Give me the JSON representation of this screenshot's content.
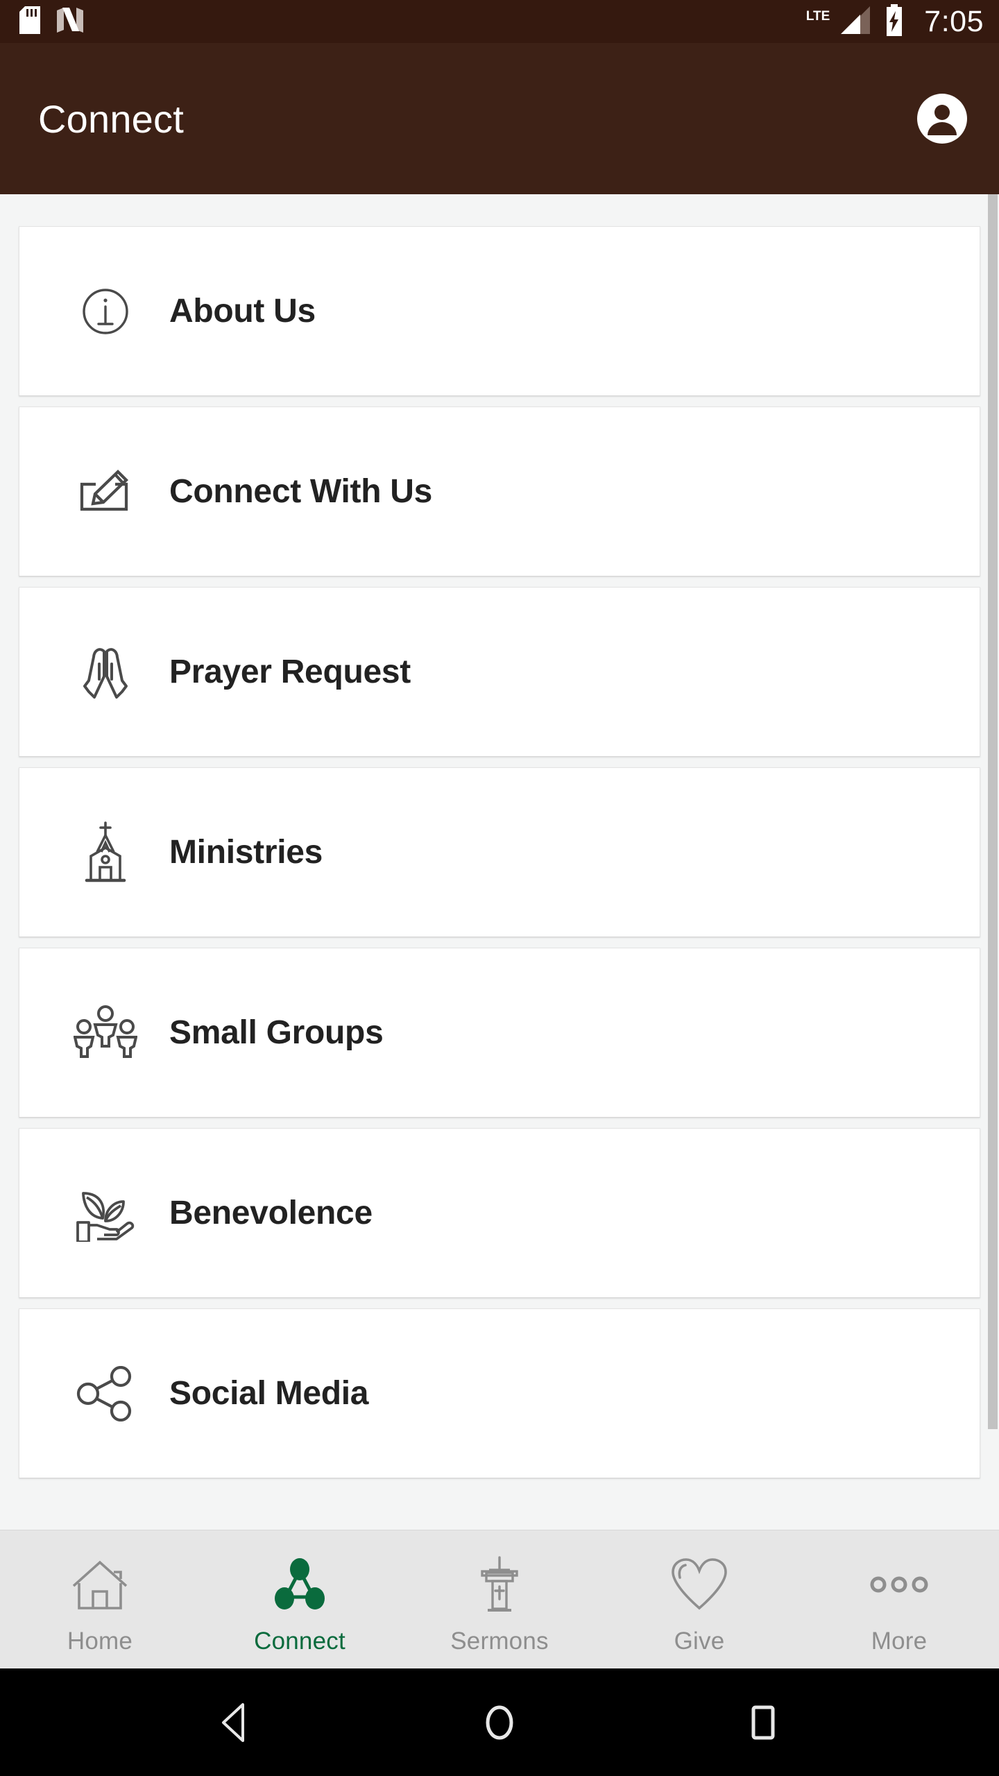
{
  "status_bar": {
    "time": "7:05",
    "network_label": "LTE",
    "icons": [
      "sd-card-icon",
      "nfc-icon",
      "signal-bars-icon",
      "battery-charging-icon"
    ],
    "background_color": "#35190f"
  },
  "app_bar": {
    "title": "Connect",
    "background_color": "#3d2116",
    "avatar_icon": "account-circle-icon"
  },
  "content": {
    "background_color": "#f4f5f5",
    "scrollbar_visible": true,
    "items": [
      {
        "label": "About Us",
        "icon": "info-circle-icon"
      },
      {
        "label": "Connect With Us",
        "icon": "pencil-write-icon"
      },
      {
        "label": "Prayer Request",
        "icon": "praying-hands-icon"
      },
      {
        "label": "Ministries",
        "icon": "church-icon"
      },
      {
        "label": "Small Groups",
        "icon": "people-group-icon"
      },
      {
        "label": "Benevolence",
        "icon": "hand-holding-plant-icon"
      },
      {
        "label": "Social Media",
        "icon": "share-network-icon"
      }
    ]
  },
  "bottom_nav": {
    "active_color": "#0a6b3d",
    "inactive_color": "#8e8e8e",
    "background_color": "#e6e6e6",
    "items": [
      {
        "label": "Home",
        "icon": "home-icon",
        "active": false
      },
      {
        "label": "Connect",
        "icon": "connect-nodes-icon",
        "active": true
      },
      {
        "label": "Sermons",
        "icon": "pulpit-icon",
        "active": false
      },
      {
        "label": "Give",
        "icon": "heart-icon",
        "active": false
      },
      {
        "label": "More",
        "icon": "more-dots-icon",
        "active": false
      }
    ]
  },
  "android_nav": {
    "background_color": "#000000",
    "buttons": [
      {
        "name": "back-button",
        "icon": "triangle-back-icon"
      },
      {
        "name": "home-button",
        "icon": "circle-home-icon"
      },
      {
        "name": "recents-button",
        "icon": "square-recents-icon"
      }
    ]
  }
}
